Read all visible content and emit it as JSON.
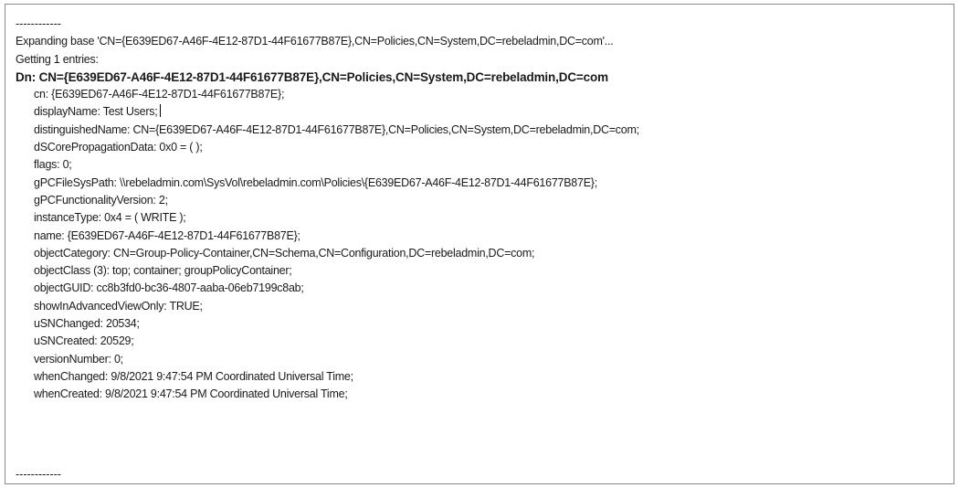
{
  "output": {
    "separator_top": "------------",
    "expanding_line": "Expanding base 'CN={E639ED67-A46F-4E12-87D1-44F61677B87E},CN=Policies,CN=System,DC=rebeladmin,DC=com'...",
    "getting_line": "Getting 1 entries:",
    "dn_line": "Dn: CN={E639ED67-A46F-4E12-87D1-44F61677B87E},CN=Policies,CN=System,DC=rebeladmin,DC=com",
    "attributes": [
      "cn: {E639ED67-A46F-4E12-87D1-44F61677B87E};",
      "displayName: Test Users;",
      "distinguishedName: CN={E639ED67-A46F-4E12-87D1-44F61677B87E},CN=Policies,CN=System,DC=rebeladmin,DC=com;",
      "dSCorePropagationData: 0x0 = ( );",
      "flags: 0;",
      "gPCFileSysPath: \\\\rebeladmin.com\\SysVol\\rebeladmin.com\\Policies\\{E639ED67-A46F-4E12-87D1-44F61677B87E};",
      "gPCFunctionalityVersion: 2;",
      "instanceType: 0x4 = ( WRITE );",
      "name: {E639ED67-A46F-4E12-87D1-44F61677B87E};",
      "objectCategory: CN=Group-Policy-Container,CN=Schema,CN=Configuration,DC=rebeladmin,DC=com;",
      "objectClass (3): top; container; groupPolicyContainer;",
      "objectGUID: cc8b3fd0-bc36-4807-aaba-06eb7199c8ab;",
      "showInAdvancedViewOnly: TRUE;",
      "uSNChanged: 20534;",
      "uSNCreated: 20529;",
      "versionNumber: 0;",
      "whenChanged: 9/8/2021 9:47:54 PM Coordinated Universal Time;",
      "whenCreated: 9/8/2021 9:47:54 PM Coordinated Universal Time;"
    ],
    "separator_bottom": "------------"
  }
}
